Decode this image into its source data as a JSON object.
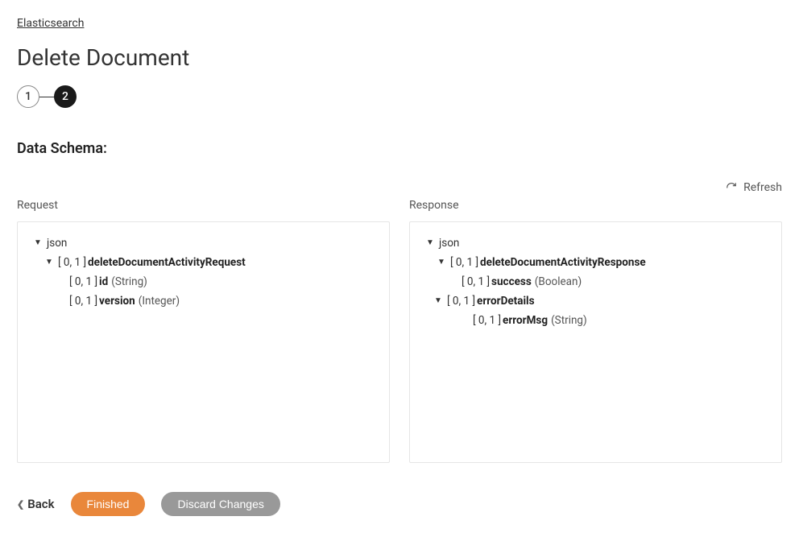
{
  "breadcrumb": {
    "label": "Elasticsearch"
  },
  "page_title": "Delete Document",
  "stepper": {
    "step1": "1",
    "step2": "2"
  },
  "section_title": "Data Schema:",
  "refresh": {
    "label": "Refresh"
  },
  "columns": {
    "request_label": "Request",
    "response_label": "Response"
  },
  "request_tree": {
    "root": "json",
    "node0": {
      "prefix": "[ 0, 1 ]",
      "name": "deleteDocumentActivityRequest"
    },
    "node1": {
      "prefix": "[ 0, 1 ]",
      "name": "id",
      "type": "(String)"
    },
    "node2": {
      "prefix": "[ 0, 1 ]",
      "name": "version",
      "type": "(Integer)"
    }
  },
  "response_tree": {
    "root": "json",
    "node0": {
      "prefix": "[ 0, 1 ]",
      "name": "deleteDocumentActivityResponse"
    },
    "node1": {
      "prefix": "[ 0, 1 ]",
      "name": "success",
      "type": "(Boolean)"
    },
    "node2": {
      "prefix": "[ 0, 1 ]",
      "name": "errorDetails"
    },
    "node3": {
      "prefix": "[ 0, 1 ]",
      "name": "errorMsg",
      "type": "(String)"
    }
  },
  "footer": {
    "back": "Back",
    "finished": "Finished",
    "discard": "Discard Changes"
  }
}
